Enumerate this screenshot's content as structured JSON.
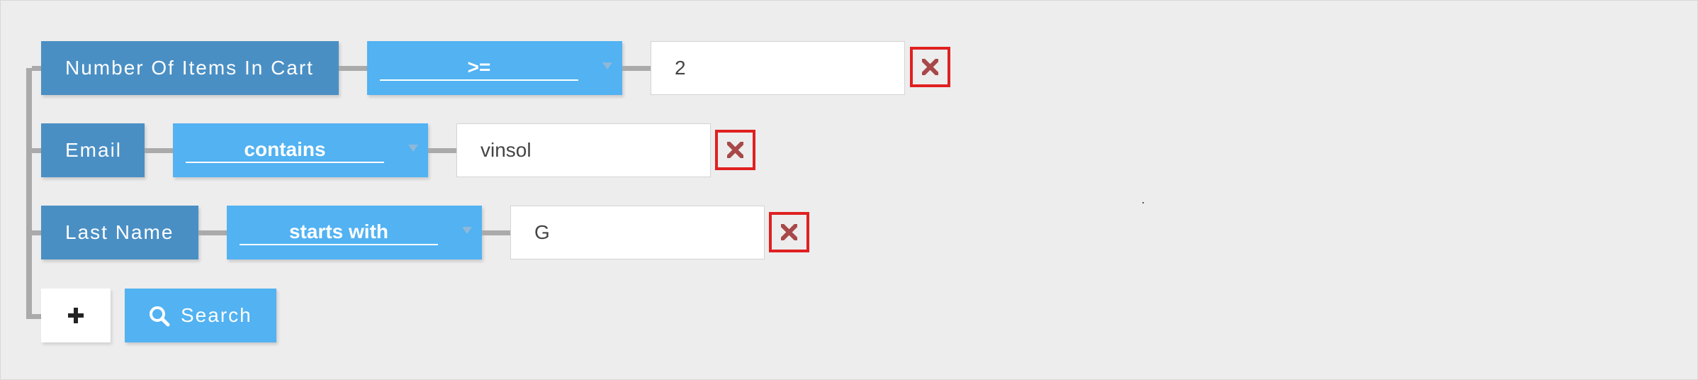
{
  "conditions": [
    {
      "field_label": "Number Of Items In Cart",
      "operator": ">=",
      "value": "2"
    },
    {
      "field_label": "Email",
      "operator": "contains",
      "value": "vinsol"
    },
    {
      "field_label": "Last Name",
      "operator": "starts with",
      "value": "G"
    }
  ],
  "actions": {
    "add_icon": "plus-icon",
    "search_icon": "search-icon",
    "search_label": "Search",
    "remove_icon": "close-icon"
  },
  "colors": {
    "background": "#ededed",
    "field": "#4a8fc4",
    "operator": "#52b2f2",
    "connector": "#aaaaaa",
    "remove_border": "#e02020",
    "remove_icon": "#a84848"
  }
}
